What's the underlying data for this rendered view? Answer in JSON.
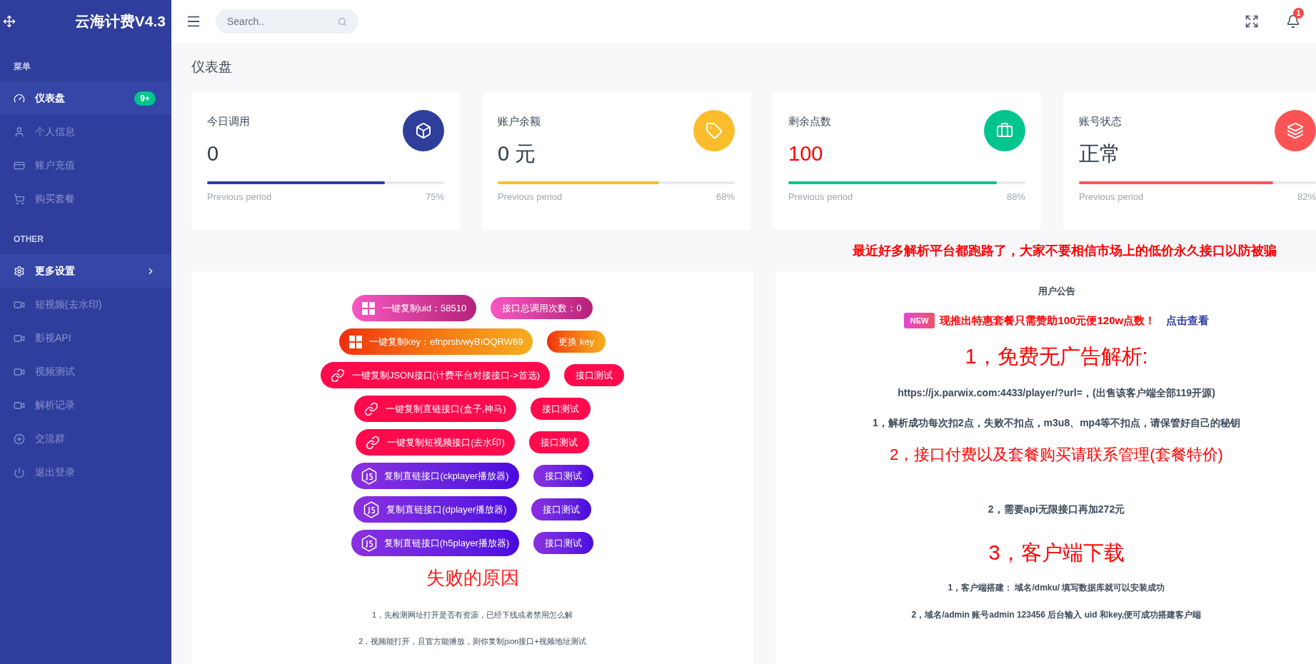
{
  "sidebar": {
    "brand": "云海计费V4.3",
    "sections": [
      {
        "heading": "菜单",
        "items": [
          {
            "label": "仪表盘",
            "selected": true,
            "badge": "9+",
            "submenu": false
          },
          {
            "label": "个人信息",
            "selected": false,
            "submenu": false
          },
          {
            "label": "账户充值",
            "selected": false,
            "submenu": false
          },
          {
            "label": "购买套餐",
            "selected": false,
            "submenu": false
          }
        ]
      },
      {
        "heading": "OTHER",
        "items": [
          {
            "label": "更多设置",
            "selected": true,
            "submenu": true
          },
          {
            "label": "短视频(去水印)",
            "selected": false,
            "submenu": false
          },
          {
            "label": "影视API",
            "selected": false,
            "submenu": false
          },
          {
            "label": "视频测试",
            "selected": false,
            "submenu": false
          },
          {
            "label": "解析记录",
            "selected": false,
            "submenu": false
          },
          {
            "label": "交流群",
            "selected": false,
            "submenu": false
          },
          {
            "label": "退出登录",
            "selected": false,
            "submenu": false
          }
        ]
      }
    ]
  },
  "topbar": {
    "search": {
      "placeholder": "Search.."
    },
    "notifications": "1"
  },
  "page_title": "仪表盘",
  "stats": [
    {
      "title": "今日调用",
      "value": "0",
      "highlight": false,
      "footer": "Previous period",
      "percent": "75%",
      "level": 0.75,
      "color": "#2e3e9a"
    },
    {
      "title": "账户余额",
      "value": "0 元",
      "highlight": false,
      "footer": "Previous period",
      "percent": "68%",
      "level": 0.68,
      "color": "#fbbd2c"
    },
    {
      "title": "剩余点数",
      "value": "100",
      "highlight": true,
      "footer": "Previous period",
      "percent": "88%",
      "level": 0.88,
      "color": "#02c58d"
    },
    {
      "title": "账号状态",
      "value": "正常",
      "highlight": false,
      "footer": "Previous period",
      "percent": "82%",
      "level": 0.82,
      "color": "#fc5454"
    }
  ],
  "ticker": "最近好多解析平台都跑路了，大家不要相信市场上的低价永久接口以防被骗",
  "actions": [
    {
      "kind": "pink",
      "copy": "一键复制uid：58510",
      "side": "接口总调用次数：0"
    },
    {
      "kind": "orange",
      "copy": "一键复制key：efnprstvwyBIOQRW69",
      "side": "更换 key"
    },
    {
      "kind": "red",
      "copy": "一键复制JSON接口(计费平台对接接口->首选)",
      "side": "接口测试"
    },
    {
      "kind": "red",
      "copy": "一键复制直链接口(盒子,神马)",
      "side": "接口测试"
    },
    {
      "kind": "red",
      "copy": "一键复制短视频接口(去水印)",
      "side": "接口测试"
    },
    {
      "kind": "purple",
      "copy": "复制直链接口(ckplayer播放器)",
      "side": "接口测试"
    },
    {
      "kind": "purple",
      "copy": "复制直链接口(dplayer播放器)",
      "side": "接口测试"
    },
    {
      "kind": "purple",
      "copy": "复制直链接口(h5player播放器)",
      "side": "接口测试"
    }
  ],
  "failure": {
    "title": "失败的原因",
    "lines": [
      "1，先检测网址打开是否有资源，已经下线或者禁用怎么解",
      "2，视频能打开，且官方能播放，则你复制json接口+视频地址测试"
    ]
  },
  "announcement": {
    "title": "用户公告",
    "promo": {
      "badge": "NEW",
      "text": "现推出特惠套餐只需赞助100元便120w点数！",
      "link": "点击查看"
    },
    "blocks": [
      {
        "kind": "heading",
        "text": "1，免费无广告解析:"
      },
      {
        "kind": "text",
        "text": "https://jx.parwix.com:4433/player/?url=，(出售该客户端全部119开源)"
      },
      {
        "kind": "text",
        "text": "1，解析成功每次扣2点，失败不扣点，m3u8、mp4等不扣点，请保管好自己的秘钥"
      },
      {
        "kind": "subheading",
        "text": "2，接口付费以及套餐购买请联系管理(套餐特价)"
      },
      {
        "kind": "spacer"
      },
      {
        "kind": "text",
        "text": "2，需要api无限接口再加272元"
      },
      {
        "kind": "heading",
        "text": "3，客户端下载"
      },
      {
        "kind": "small",
        "text": "1，客户端搭建： 域名/dmku/ 填写数据库就可以安装成功"
      },
      {
        "kind": "small",
        "text": "2，域名/admin 账号admin 123456 后台输入 uid 和key,便可成功搭建客户端"
      }
    ]
  }
}
